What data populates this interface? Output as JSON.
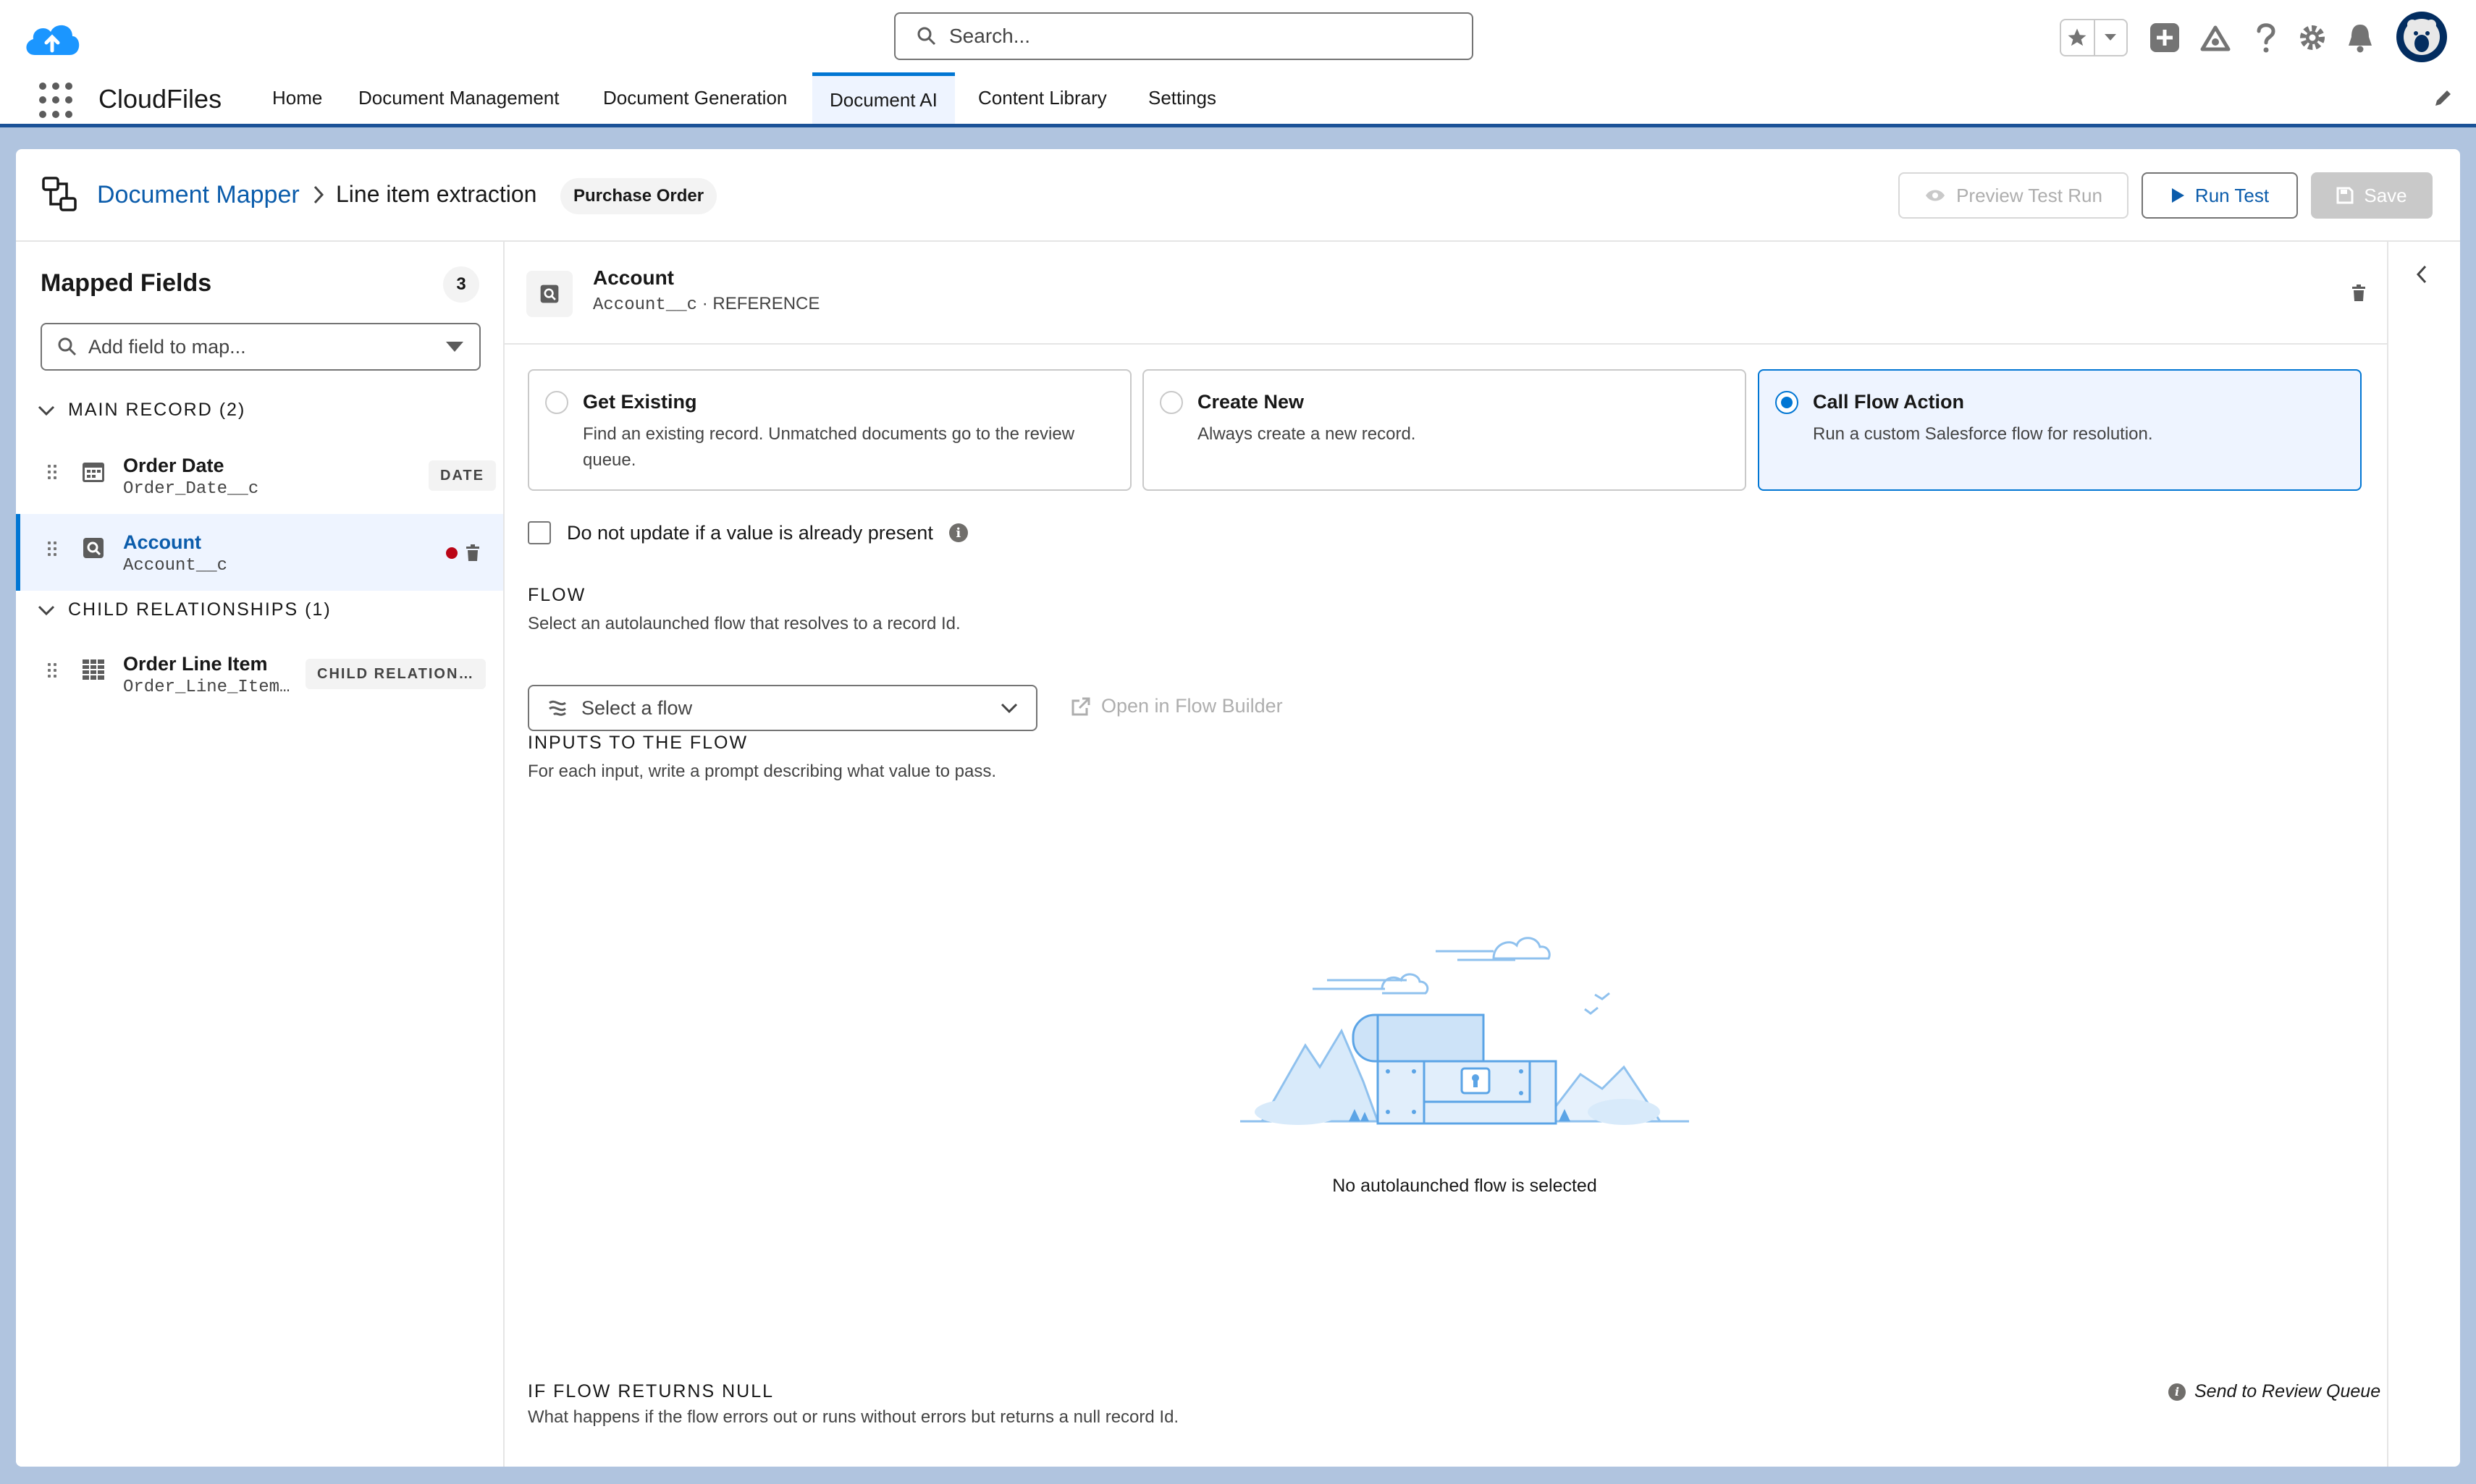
{
  "header": {
    "search_placeholder": "Search..."
  },
  "nav": {
    "app_name": "CloudFiles",
    "tabs": [
      {
        "label": "Home"
      },
      {
        "label": "Document Management"
      },
      {
        "label": "Document Generation"
      },
      {
        "label": "Document AI"
      },
      {
        "label": "Content Library"
      },
      {
        "label": "Settings"
      }
    ],
    "active_tab": "Document AI"
  },
  "page": {
    "breadcrumb_root": "Document Mapper",
    "breadcrumb_current": "Line item extraction",
    "doc_type_pill": "Purchase Order",
    "buttons": {
      "preview": "Preview Test Run",
      "run": "Run Test",
      "save": "Save"
    }
  },
  "mapped_fields": {
    "title": "Mapped Fields",
    "count": "3",
    "add_placeholder": "Add field to map...",
    "main_record_heading": "MAIN RECORD (2)",
    "child_heading": "CHILD RELATIONSHIPS (1)",
    "main_items": [
      {
        "label": "Order Date",
        "api": "Order_Date__c",
        "type": "DATE",
        "icon": "calendar-icon"
      },
      {
        "label": "Account",
        "api": "Account__c",
        "type": "",
        "icon": "reference-icon",
        "selected": true
      }
    ],
    "child_items": [
      {
        "label": "Order Line Item",
        "api": "Order_Line_Item…",
        "type": "CHILD RELATION…",
        "icon": "table-icon"
      }
    ]
  },
  "detail": {
    "title": "Account",
    "api": "Account__c",
    "kind": "REFERENCE",
    "separator": "·",
    "options": [
      {
        "title": "Get Existing",
        "desc": "Find an existing record. Unmatched documents go to the review queue.",
        "selected": false
      },
      {
        "title": "Create New",
        "desc": "Always create a new record.",
        "selected": false
      },
      {
        "title": "Call Flow Action",
        "desc": "Run a custom Salesforce flow for resolution.",
        "selected": true
      }
    ],
    "no_update_label": "Do not update if a value is already present",
    "flow_heading": "FLOW",
    "flow_help": "Select an autolaunched flow that resolves to a record Id.",
    "flow_placeholder": "Select a flow",
    "flow_link": "Open in Flow Builder",
    "inputs_heading": "INPUTS TO THE FLOW",
    "inputs_help": "For each input, write a prompt describing what value to pass.",
    "empty_text": "No autolaunched flow is selected",
    "null_heading": "IF FLOW RETURNS NULL",
    "null_help": "What happens if the flow errors out or runs without errors but returns a null record Id.",
    "null_action": "Send to Review Queue"
  },
  "colors": {
    "brand_blue": "#0176d3",
    "link_blue": "#0b5cab",
    "nav_band": "#1b5297",
    "selected_bg": "#eef4ff",
    "error_dot": "#ba0517"
  }
}
